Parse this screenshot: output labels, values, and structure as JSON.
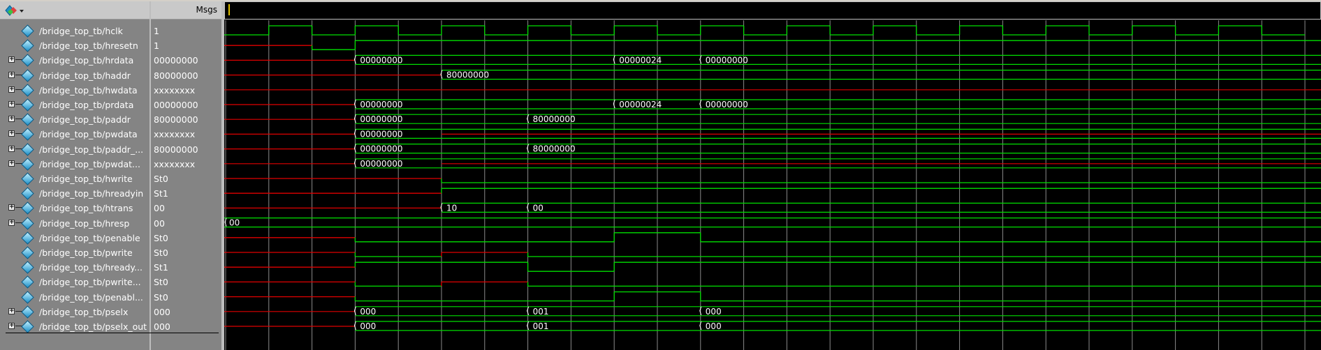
{
  "toolbar": {
    "logo_icon": "wave-window-logo-icon",
    "msgs_label": "Msgs"
  },
  "signals": [
    {
      "name": "/bridge_top_tb/hclk",
      "value": "1",
      "expandable": false
    },
    {
      "name": "/bridge_top_tb/hresetn",
      "value": "1",
      "expandable": false
    },
    {
      "name": "/bridge_top_tb/hrdata",
      "value": "00000000",
      "expandable": true
    },
    {
      "name": "/bridge_top_tb/haddr",
      "value": "80000000",
      "expandable": true
    },
    {
      "name": "/bridge_top_tb/hwdata",
      "value": "xxxxxxxx",
      "expandable": true
    },
    {
      "name": "/bridge_top_tb/prdata",
      "value": "00000000",
      "expandable": true
    },
    {
      "name": "/bridge_top_tb/paddr",
      "value": "80000000",
      "expandable": true
    },
    {
      "name": "/bridge_top_tb/pwdata",
      "value": "xxxxxxxx",
      "expandable": true
    },
    {
      "name": "/bridge_top_tb/paddr_...",
      "value": "80000000",
      "expandable": true
    },
    {
      "name": "/bridge_top_tb/pwdat...",
      "value": "xxxxxxxx",
      "expandable": true
    },
    {
      "name": "/bridge_top_tb/hwrite",
      "value": "St0",
      "expandable": false
    },
    {
      "name": "/bridge_top_tb/hreadyin",
      "value": "St1",
      "expandable": false
    },
    {
      "name": "/bridge_top_tb/htrans",
      "value": "00",
      "expandable": true
    },
    {
      "name": "/bridge_top_tb/hresp",
      "value": "00",
      "expandable": true
    },
    {
      "name": "/bridge_top_tb/penable",
      "value": "St0",
      "expandable": false
    },
    {
      "name": "/bridge_top_tb/pwrite",
      "value": "St0",
      "expandable": false
    },
    {
      "name": "/bridge_top_tb/hready...",
      "value": "St1",
      "expandable": false
    },
    {
      "name": "/bridge_top_tb/pwrite...",
      "value": "St0",
      "expandable": false
    },
    {
      "name": "/bridge_top_tb/penabl...",
      "value": "St0",
      "expandable": false
    },
    {
      "name": "/bridge_top_tb/pselx",
      "value": "000",
      "expandable": true
    },
    {
      "name": "/bridge_top_tb/pselx_out",
      "value": "000",
      "expandable": true
    }
  ],
  "waveforms": {
    "bus_labels": [
      {
        "row": 2,
        "segments": [
          {
            "from": 3,
            "text": "00000000"
          },
          {
            "from": 9,
            "text": "00000024"
          },
          {
            "from": 11,
            "text": "00000000"
          }
        ]
      },
      {
        "row": 3,
        "segments": [
          {
            "from": 5,
            "text": "80000000"
          }
        ]
      },
      {
        "row": 5,
        "segments": [
          {
            "from": 3,
            "text": "00000000"
          },
          {
            "from": 9,
            "text": "00000024"
          },
          {
            "from": 11,
            "text": "00000000"
          }
        ]
      },
      {
        "row": 6,
        "segments": [
          {
            "from": 3,
            "text": "00000000"
          },
          {
            "from": 7,
            "text": "80000000"
          }
        ]
      },
      {
        "row": 7,
        "segments": [
          {
            "from": 3,
            "text": "00000000"
          }
        ]
      },
      {
        "row": 8,
        "segments": [
          {
            "from": 3,
            "text": "00000000"
          },
          {
            "from": 7,
            "text": "80000000"
          }
        ]
      },
      {
        "row": 9,
        "segments": [
          {
            "from": 3,
            "text": "00000000"
          }
        ]
      },
      {
        "row": 12,
        "segments": [
          {
            "from": 5,
            "text": "10"
          },
          {
            "from": 7,
            "text": "00"
          }
        ]
      },
      {
        "row": 13,
        "segments": [
          {
            "from": 0,
            "text": "00"
          }
        ]
      },
      {
        "row": 19,
        "segments": [
          {
            "from": 3,
            "text": "000"
          },
          {
            "from": 7,
            "text": "001"
          },
          {
            "from": 11,
            "text": "000"
          }
        ]
      },
      {
        "row": 20,
        "segments": [
          {
            "from": 3,
            "text": "000"
          },
          {
            "from": 7,
            "text": "001"
          },
          {
            "from": 11,
            "text": "000"
          }
        ]
      }
    ],
    "colors": {
      "active": "#00e000",
      "undefined": "#e00000",
      "grid": "#8a8a8a",
      "background": "#000000"
    }
  }
}
